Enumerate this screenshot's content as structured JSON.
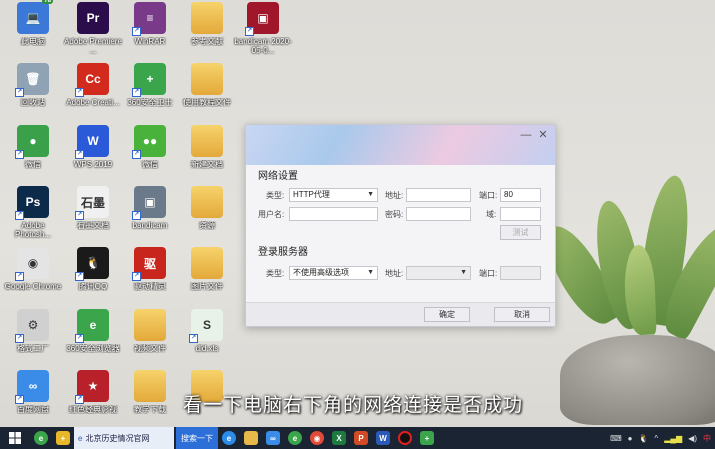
{
  "desktop_icons": [
    {
      "label": "此电脑",
      "badge": "78",
      "color": "#3b78d8",
      "glyph": "💻",
      "icon": "computer-icon"
    },
    {
      "label": "Adobe Premiere ...",
      "color": "#2a0d4a",
      "glyph": "Pr",
      "icon": "premiere-icon"
    },
    {
      "label": "WinRAR",
      "color": "#7a3a8a",
      "glyph": "≡",
      "icon": "winrar-icon"
    },
    {
      "label": "参考文献",
      "color": "folder",
      "glyph": "",
      "icon": "folder-icon"
    },
    {
      "label": "bandicam 2020-05-0...",
      "color": "#a0172b",
      "glyph": "▣",
      "icon": "video-file-icon"
    },
    {
      "label": "回收站",
      "color": "#8fa3b5",
      "glyph": "🗑",
      "icon": "recycle-bin-icon"
    },
    {
      "label": "Adobe Creati...",
      "color": "#d22a1c",
      "glyph": "Cc",
      "icon": "creative-cloud-icon"
    },
    {
      "label": "360安全卫士",
      "color": "#3aa54a",
      "glyph": "+",
      "icon": "360-security-icon"
    },
    {
      "label": "使用教程文件",
      "color": "folder",
      "glyph": "",
      "icon": "folder-icon"
    },
    {
      "label": "微信",
      "color": "#3aa14a",
      "glyph": "●",
      "icon": "wechat-icon"
    },
    {
      "label": "WPS 2019",
      "color": "#2a5ad8",
      "glyph": "W",
      "icon": "wps-icon"
    },
    {
      "label": "微信",
      "color": "#49b23a",
      "glyph": "●●",
      "icon": "wechat-icon"
    },
    {
      "label": "新建文档",
      "color": "folder",
      "glyph": "",
      "icon": "folder-icon"
    },
    {
      "label": "Adobe Photosh...",
      "color": "#0c2a4a",
      "glyph": "Ps",
      "icon": "photoshop-icon"
    },
    {
      "label": "石墨文档",
      "color": "#f0f0f0",
      "glyph": "石墨",
      "icon": "shimo-icon"
    },
    {
      "label": "bandicam",
      "color": "#6b7a8a",
      "glyph": "▣",
      "icon": "bandicam-icon"
    },
    {
      "label": "资源",
      "color": "folder",
      "glyph": "",
      "icon": "folder-icon"
    },
    {
      "label": "Google Chrome",
      "color": "#e4e4e4",
      "glyph": "◉",
      "icon": "chrome-icon"
    },
    {
      "label": "腾讯QQ",
      "color": "#1a1a1a",
      "glyph": "🐧",
      "icon": "qq-icon"
    },
    {
      "label": "驱动精灵",
      "color": "#c8261c",
      "glyph": "驱",
      "icon": "driver-icon"
    },
    {
      "label": "图片文件",
      "color": "folder",
      "glyph": "",
      "icon": "folder-icon"
    },
    {
      "label": "格式工厂",
      "color": "#d0d0d0",
      "glyph": "⚙",
      "icon": "format-factory-icon"
    },
    {
      "label": "360安全浏览器",
      "color": "#3aa54a",
      "glyph": "e",
      "icon": "360-browser-icon"
    },
    {
      "label": "视频文件",
      "color": "folder",
      "glyph": "",
      "icon": "folder-icon"
    },
    {
      "label": "dld.xls",
      "color": "#e8f2e8",
      "glyph": "S",
      "icon": "spreadsheet-icon"
    },
    {
      "label": "百度网盘",
      "color": "#3a8ce8",
      "glyph": "∞",
      "icon": "baidu-netdisk-icon"
    },
    {
      "label": "红色经典影视",
      "color": "#b8202a",
      "glyph": "★",
      "icon": "red-classic-icon"
    },
    {
      "label": "教学下载",
      "color": "folder",
      "glyph": "",
      "icon": "folder-icon"
    },
    {
      "label": "",
      "color": "folder",
      "glyph": "",
      "icon": "folder-icon"
    }
  ],
  "dialog": {
    "section_network": "网络设置",
    "type_label": "类型:",
    "type_value": "HTTP代理",
    "address_label": "地址:",
    "address_value": "",
    "port_label": "端口:",
    "port_value": "80",
    "username_label": "用户名:",
    "username_value": "",
    "password_label": "密码:",
    "password_value": "",
    "domain_label": "域:",
    "domain_value": "",
    "test_button": "测试",
    "section_login": "登录服务器",
    "login_type_label": "类型:",
    "login_type_value": "不使用高级选项",
    "login_address_label": "地址:",
    "login_address_value": "",
    "login_port_label": "端口:",
    "login_port_value": "",
    "ok_button": "确定",
    "cancel_button": "取消"
  },
  "subtitle": "看一下电脑右下角的网络连接是否成功",
  "taskbar": {
    "tab_title": "北京历史情况官网",
    "search_label": "搜索一下",
    "ime_label": "中"
  }
}
